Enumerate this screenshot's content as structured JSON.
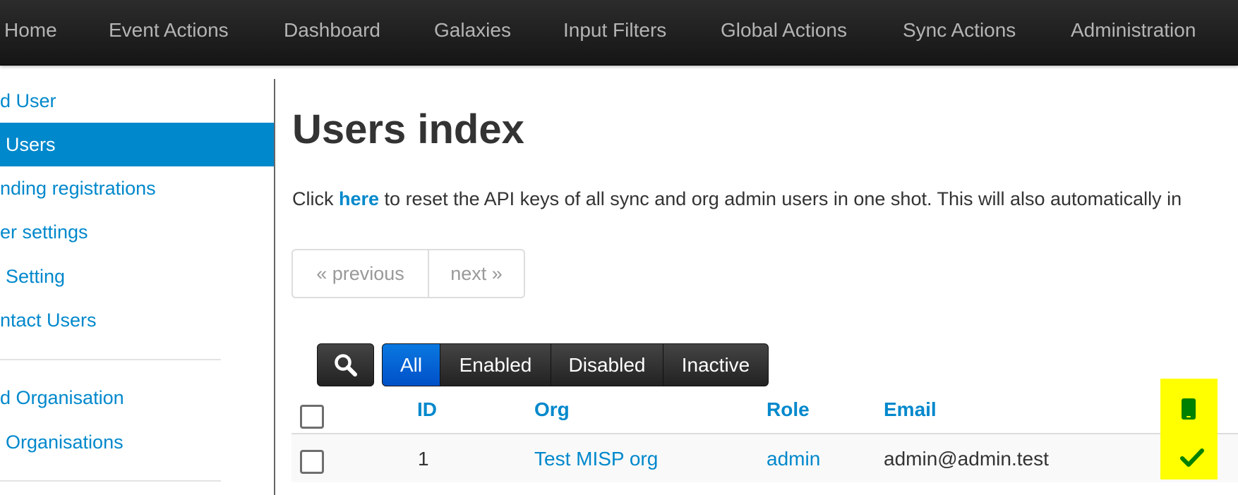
{
  "topnav": {
    "items": [
      "Home",
      "Event Actions",
      "Dashboard",
      "Galaxies",
      "Input Filters",
      "Global Actions",
      "Sync Actions",
      "Administration"
    ]
  },
  "sidebar": {
    "items": [
      {
        "label": "d User"
      },
      {
        "label": "Users",
        "active": true
      },
      {
        "label": "nding registrations"
      },
      {
        "label": "er settings"
      },
      {
        "label": "Setting"
      },
      {
        "label": "ntact Users"
      },
      {
        "label": "d Organisation"
      },
      {
        "label": "Organisations"
      }
    ]
  },
  "main": {
    "title": "Users index",
    "info": {
      "prefix": "Click ",
      "link": "here",
      "suffix": " to reset the API keys of all sync and org admin users in one shot. This will also automatically in"
    },
    "pagination": {
      "previous": "« previous",
      "next": "next »"
    },
    "filters": [
      "All",
      "Enabled",
      "Disabled",
      "Inactive"
    ],
    "table": {
      "headers": {
        "id": "ID",
        "org": "Org",
        "role": "Role",
        "email": "Email"
      },
      "rows": [
        {
          "id": "1",
          "org": "Test MISP org",
          "role": "admin",
          "email": "admin@admin.test"
        }
      ]
    }
  },
  "icons": {
    "search": "search-icon",
    "mobile": "mobile-phone-icon",
    "check": "checkmark-icon"
  },
  "colors": {
    "link": "#0088cc",
    "active_sidebar": "#0088cc",
    "active_filter": "#0a6fe0",
    "highlight": "#ffff00",
    "check": "#008000"
  }
}
